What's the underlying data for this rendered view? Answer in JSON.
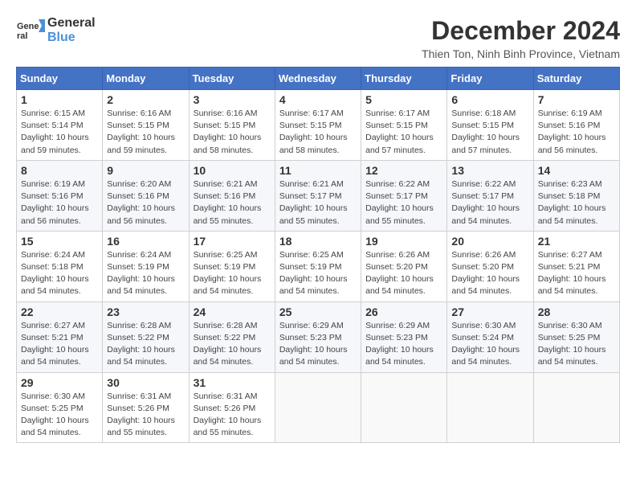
{
  "logo": {
    "line1": "General",
    "line2": "Blue"
  },
  "title": "December 2024",
  "subtitle": "Thien Ton, Ninh Binh Province, Vietnam",
  "days_header": [
    "Sunday",
    "Monday",
    "Tuesday",
    "Wednesday",
    "Thursday",
    "Friday",
    "Saturday"
  ],
  "weeks": [
    [
      {
        "day": "1",
        "sunrise": "6:15 AM",
        "sunset": "5:14 PM",
        "daylight": "10 hours and 59 minutes."
      },
      {
        "day": "2",
        "sunrise": "6:16 AM",
        "sunset": "5:15 PM",
        "daylight": "10 hours and 59 minutes."
      },
      {
        "day": "3",
        "sunrise": "6:16 AM",
        "sunset": "5:15 PM",
        "daylight": "10 hours and 58 minutes."
      },
      {
        "day": "4",
        "sunrise": "6:17 AM",
        "sunset": "5:15 PM",
        "daylight": "10 hours and 58 minutes."
      },
      {
        "day": "5",
        "sunrise": "6:17 AM",
        "sunset": "5:15 PM",
        "daylight": "10 hours and 57 minutes."
      },
      {
        "day": "6",
        "sunrise": "6:18 AM",
        "sunset": "5:15 PM",
        "daylight": "10 hours and 57 minutes."
      },
      {
        "day": "7",
        "sunrise": "6:19 AM",
        "sunset": "5:16 PM",
        "daylight": "10 hours and 56 minutes."
      }
    ],
    [
      {
        "day": "8",
        "sunrise": "6:19 AM",
        "sunset": "5:16 PM",
        "daylight": "10 hours and 56 minutes."
      },
      {
        "day": "9",
        "sunrise": "6:20 AM",
        "sunset": "5:16 PM",
        "daylight": "10 hours and 56 minutes."
      },
      {
        "day": "10",
        "sunrise": "6:21 AM",
        "sunset": "5:16 PM",
        "daylight": "10 hours and 55 minutes."
      },
      {
        "day": "11",
        "sunrise": "6:21 AM",
        "sunset": "5:17 PM",
        "daylight": "10 hours and 55 minutes."
      },
      {
        "day": "12",
        "sunrise": "6:22 AM",
        "sunset": "5:17 PM",
        "daylight": "10 hours and 55 minutes."
      },
      {
        "day": "13",
        "sunrise": "6:22 AM",
        "sunset": "5:17 PM",
        "daylight": "10 hours and 54 minutes."
      },
      {
        "day": "14",
        "sunrise": "6:23 AM",
        "sunset": "5:18 PM",
        "daylight": "10 hours and 54 minutes."
      }
    ],
    [
      {
        "day": "15",
        "sunrise": "6:24 AM",
        "sunset": "5:18 PM",
        "daylight": "10 hours and 54 minutes."
      },
      {
        "day": "16",
        "sunrise": "6:24 AM",
        "sunset": "5:19 PM",
        "daylight": "10 hours and 54 minutes."
      },
      {
        "day": "17",
        "sunrise": "6:25 AM",
        "sunset": "5:19 PM",
        "daylight": "10 hours and 54 minutes."
      },
      {
        "day": "18",
        "sunrise": "6:25 AM",
        "sunset": "5:19 PM",
        "daylight": "10 hours and 54 minutes."
      },
      {
        "day": "19",
        "sunrise": "6:26 AM",
        "sunset": "5:20 PM",
        "daylight": "10 hours and 54 minutes."
      },
      {
        "day": "20",
        "sunrise": "6:26 AM",
        "sunset": "5:20 PM",
        "daylight": "10 hours and 54 minutes."
      },
      {
        "day": "21",
        "sunrise": "6:27 AM",
        "sunset": "5:21 PM",
        "daylight": "10 hours and 54 minutes."
      }
    ],
    [
      {
        "day": "22",
        "sunrise": "6:27 AM",
        "sunset": "5:21 PM",
        "daylight": "10 hours and 54 minutes."
      },
      {
        "day": "23",
        "sunrise": "6:28 AM",
        "sunset": "5:22 PM",
        "daylight": "10 hours and 54 minutes."
      },
      {
        "day": "24",
        "sunrise": "6:28 AM",
        "sunset": "5:22 PM",
        "daylight": "10 hours and 54 minutes."
      },
      {
        "day": "25",
        "sunrise": "6:29 AM",
        "sunset": "5:23 PM",
        "daylight": "10 hours and 54 minutes."
      },
      {
        "day": "26",
        "sunrise": "6:29 AM",
        "sunset": "5:23 PM",
        "daylight": "10 hours and 54 minutes."
      },
      {
        "day": "27",
        "sunrise": "6:30 AM",
        "sunset": "5:24 PM",
        "daylight": "10 hours and 54 minutes."
      },
      {
        "day": "28",
        "sunrise": "6:30 AM",
        "sunset": "5:25 PM",
        "daylight": "10 hours and 54 minutes."
      }
    ],
    [
      {
        "day": "29",
        "sunrise": "6:30 AM",
        "sunset": "5:25 PM",
        "daylight": "10 hours and 54 minutes."
      },
      {
        "day": "30",
        "sunrise": "6:31 AM",
        "sunset": "5:26 PM",
        "daylight": "10 hours and 55 minutes."
      },
      {
        "day": "31",
        "sunrise": "6:31 AM",
        "sunset": "5:26 PM",
        "daylight": "10 hours and 55 minutes."
      },
      null,
      null,
      null,
      null
    ]
  ]
}
